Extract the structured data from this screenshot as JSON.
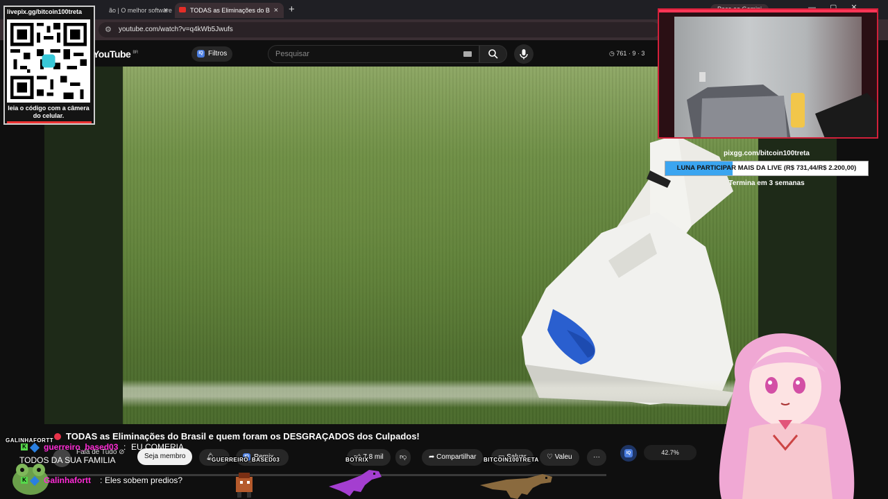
{
  "browser": {
    "tabs": [
      {
        "label": "ão | O melhor software p"
      },
      {
        "label": "TODAS as Eliminações do B"
      }
    ],
    "new_tab": "+",
    "close_glyph": "×",
    "gemini_button": "Peça ao Gemini",
    "url": "youtube.com/watch?v=q4kWb5Jwufs"
  },
  "youtube": {
    "logo": "YouTube",
    "region": "BR",
    "filters_label": "Filtros",
    "iq_badge": "IQ",
    "search_placeholder": "Pesquisar",
    "stats": "761 · 9 · 3"
  },
  "overlay": {
    "qr": {
      "title": "livepix.gg/bitcoin100treta",
      "caption": "leia o código com a câmera do celular."
    },
    "goal": {
      "url": "pixgg.com/bitcoin100treta",
      "text": "LUNA PARTICIPAR MAIS DA LIVE (R$ 731,44/R$ 2.200,00)",
      "progress": 0.3325,
      "ends": "Termina em 3 semanas"
    },
    "pix_tags": [
      "GALINHAFORTT",
      "GUERREIRO_BASED03",
      "BOTRIX",
      "BITCOIN100TRETA"
    ],
    "chat": [
      {
        "name": "guerreiro_based03",
        "sep": ":",
        "message": "EU COMERIA",
        "continuation": "TODOS DA SUA FAMILIA"
      },
      {
        "name": "Galinhafortt",
        "sep": ":",
        "message": "Eles sobem predios?"
      }
    ]
  },
  "video": {
    "title": "TODAS as Eliminações do Brasil e quem foram os DESGRAÇADOS dos Culpados!",
    "channel": "Fala de Tudo",
    "channel_verified": "⊘",
    "join_label": "Seja membro",
    "remix_label": "Remix",
    "likes": "7,8 mil",
    "share_label": "Compartilhar",
    "save_label": "Salvar",
    "thanks_label": "Valeu",
    "more_label": "···",
    "iq_percent": "42.7%"
  },
  "colors": {
    "accent_red": "#e8334a",
    "goal_fill": "#3ba5f0",
    "chat_name": "#ff2bd6",
    "webcam_border": "#d2203a"
  },
  "icons": [
    "search-icon",
    "mic-icon",
    "bell-icon",
    "like-icon",
    "dislike-icon",
    "share-icon",
    "save-icon",
    "thanks-icon",
    "more-icon",
    "tune-icon",
    "close-icon"
  ]
}
